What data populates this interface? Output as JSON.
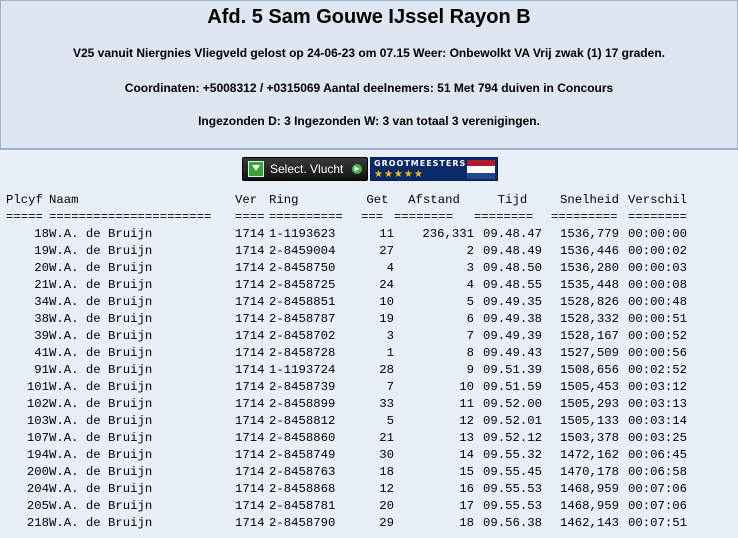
{
  "header": {
    "title": "Afd. 5 Sam Gouwe IJssel Rayon B",
    "line1": "V25 vanuit Niergnies Vliegveld gelost op 24-06-23 om 07.15 Weer: Onbewolkt VA Vrij zwak (1) 17 graden.",
    "line2": "Coordinaten: +5008312 / +0315069 Aantal deelnemers: 51 Met 794 duiven in Concours",
    "line3": "Ingezonden D: 3 Ingezonden W: 3 van totaal 3 verenigingen."
  },
  "toolbar": {
    "select_label": "Select. Vlucht",
    "logo_text": "GROOTMEESTERS",
    "logo_stars": "★★★★★",
    "flag_colors": [
      "#ae1c28",
      "#ffffff",
      "#21468b"
    ]
  },
  "table": {
    "headers": [
      "Plcyf",
      "Naam",
      "Ver",
      "Ring",
      "Get",
      "Afstand",
      "Tijd",
      "Snelheid",
      "Verschil"
    ],
    "separators": [
      "=====",
      "======================",
      "====",
      "==========",
      "===",
      "========",
      "========",
      "=========",
      "========"
    ],
    "rows": [
      [
        "18",
        "W.A. de Bruijn",
        "1714",
        "1-1193623",
        "11",
        "236,331",
        "09.48.47",
        "1536,779",
        "00:00:00"
      ],
      [
        "19",
        "W.A. de Bruijn",
        "1714",
        "2-8459004",
        "27",
        "2",
        "09.48.49",
        "1536,446",
        "00:00:02"
      ],
      [
        "20",
        "W.A. de Bruijn",
        "1714",
        "2-8458750",
        "4",
        "3",
        "09.48.50",
        "1536,280",
        "00:00:03"
      ],
      [
        "21",
        "W.A. de Bruijn",
        "1714",
        "2-8458725",
        "24",
        "4",
        "09.48.55",
        "1535,448",
        "00:00:08"
      ],
      [
        "34",
        "W.A. de Bruijn",
        "1714",
        "2-8458851",
        "10",
        "5",
        "09.49.35",
        "1528,826",
        "00:00:48"
      ],
      [
        "38",
        "W.A. de Bruijn",
        "1714",
        "2-8458787",
        "19",
        "6",
        "09.49.38",
        "1528,332",
        "00:00:51"
      ],
      [
        "39",
        "W.A. de Bruijn",
        "1714",
        "2-8458702",
        "3",
        "7",
        "09.49.39",
        "1528,167",
        "00:00:52"
      ],
      [
        "41",
        "W.A. de Bruijn",
        "1714",
        "2-8458728",
        "1",
        "8",
        "09.49.43",
        "1527,509",
        "00:00:56"
      ],
      [
        "91",
        "W.A. de Bruijn",
        "1714",
        "1-1193724",
        "28",
        "9",
        "09.51.39",
        "1508,656",
        "00:02:52"
      ],
      [
        "101",
        "W.A. de Bruijn",
        "1714",
        "2-8458739",
        "7",
        "10",
        "09.51.59",
        "1505,453",
        "00:03:12"
      ],
      [
        "102",
        "W.A. de Bruijn",
        "1714",
        "2-8458899",
        "33",
        "11",
        "09.52.00",
        "1505,293",
        "00:03:13"
      ],
      [
        "103",
        "W.A. de Bruijn",
        "1714",
        "2-8458812",
        "5",
        "12",
        "09.52.01",
        "1505,133",
        "00:03:14"
      ],
      [
        "107",
        "W.A. de Bruijn",
        "1714",
        "2-8458860",
        "21",
        "13",
        "09.52.12",
        "1503,378",
        "00:03:25"
      ],
      [
        "194",
        "W.A. de Bruijn",
        "1714",
        "2-8458749",
        "30",
        "14",
        "09.55.32",
        "1472,162",
        "00:06:45"
      ],
      [
        "200",
        "W.A. de Bruijn",
        "1714",
        "2-8458763",
        "18",
        "15",
        "09.55.45",
        "1470,178",
        "00:06:58"
      ],
      [
        "204",
        "W.A. de Bruijn",
        "1714",
        "2-8458868",
        "12",
        "16",
        "09.55.53",
        "1468,959",
        "00:07:06"
      ],
      [
        "205",
        "W.A. de Bruijn",
        "1714",
        "2-8458781",
        "20",
        "17",
        "09.55.53",
        "1468,959",
        "00:07:06"
      ],
      [
        "218",
        "W.A. de Bruijn",
        "1714",
        "2-8458790",
        "29",
        "18",
        "09.56.38",
        "1462,143",
        "00:07:51"
      ]
    ]
  }
}
